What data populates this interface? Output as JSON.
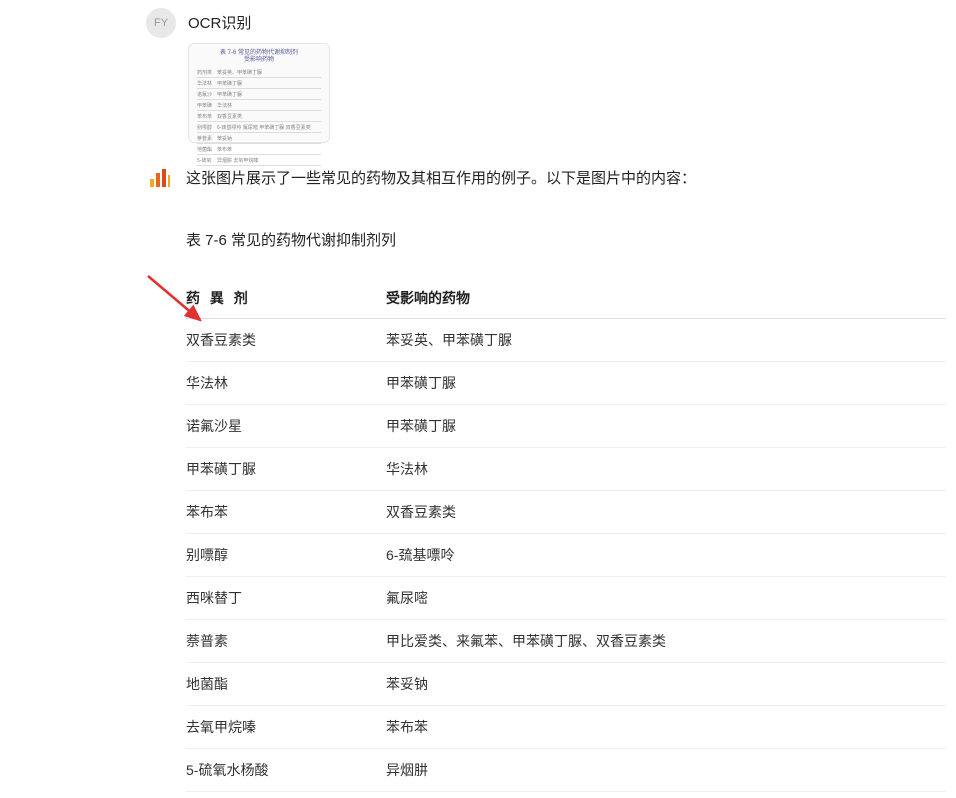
{
  "user": {
    "avatar_initials": "FY",
    "message_title": "OCR识别"
  },
  "bot": {
    "intro_text": "这张图片展示了一些常见的药物及其相互作用的例子。以下是图片中的内容：",
    "table_caption": "表 7-6 常见的药物代谢抑制剂列"
  },
  "table": {
    "header_col1": "药 異 剂",
    "header_col2": "受影响的药物",
    "rows": [
      {
        "c1": "双香豆素类",
        "c2": "苯妥英、甲苯磺丁脲"
      },
      {
        "c1": "华法林",
        "c2": "甲苯磺丁脲"
      },
      {
        "c1": "诺氟沙星",
        "c2": "甲苯磺丁脲"
      },
      {
        "c1": "甲苯磺丁脲",
        "c2": "华法林"
      },
      {
        "c1": "苯布苯",
        "c2": "双香豆素类"
      },
      {
        "c1": "别嘌醇",
        "c2": "6-巯基嘌呤"
      },
      {
        "c1": "西咪替丁",
        "c2": "氟尿嘧"
      },
      {
        "c1": "萘普素",
        "c2": "甲比爱类、来氟苯、甲苯磺丁脲、双香豆素类"
      },
      {
        "c1": "地菌酯",
        "c2": "苯妥钠"
      },
      {
        "c1": "去氧甲烷嗪",
        "c2": "苯布苯"
      },
      {
        "c1": "5-硫氧水杨酸",
        "c2": "异烟肼"
      }
    ]
  },
  "attachment_preview": {
    "title_line1": "表 7-6 常见的药物代谢抑制剂",
    "title_line2": "受影响药物",
    "lines": [
      {
        "l": "药剂类",
        "r": "苯妥英、甲苯磺丁脲"
      },
      {
        "l": "华法林",
        "r": "甲苯磺丁脲"
      },
      {
        "l": "诺氟沙",
        "r": "甲苯磺丁脲"
      },
      {
        "l": "甲苯磺",
        "r": "华法林"
      },
      {
        "l": "苯布苯",
        "r": "双香豆素类"
      },
      {
        "l": "别嘌醇",
        "r": "6-巯基嘌呤  氟尿嘧  甲苯磺丁脲 双香豆素类"
      },
      {
        "l": "萘普素",
        "r": "苯妥钠"
      },
      {
        "l": "地菌酯",
        "r": "苯布苯"
      },
      {
        "l": "5-硫氧",
        "r": "异烟肼  去氧甲烷嗪"
      }
    ]
  }
}
